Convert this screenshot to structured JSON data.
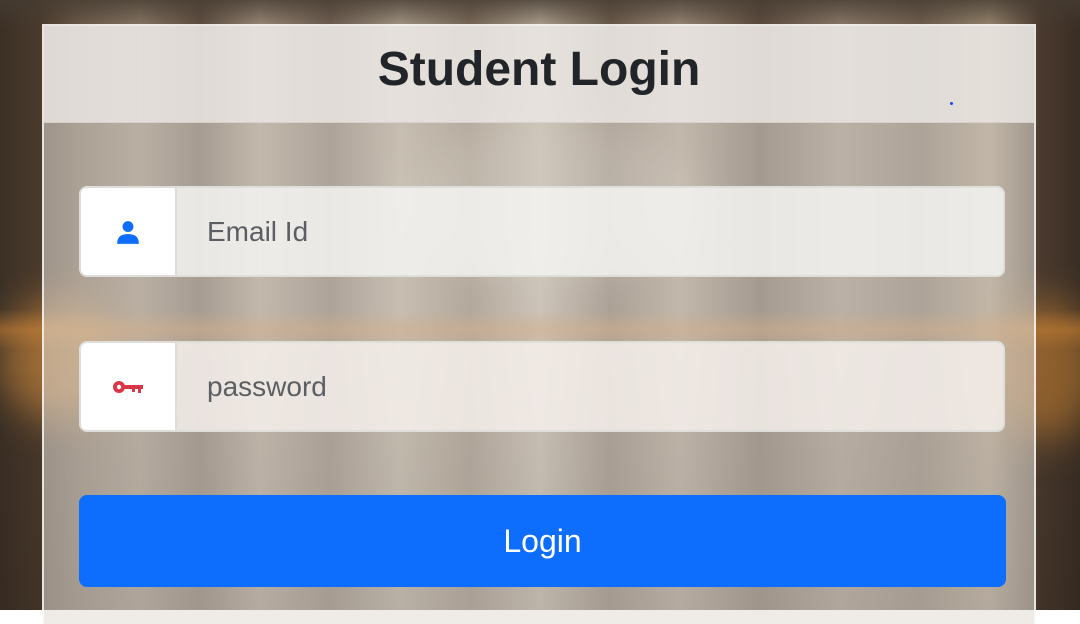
{
  "login_card": {
    "title": "Student Login",
    "email_field": {
      "placeholder": "Email Id",
      "value": "",
      "icon": "user-icon",
      "icon_color": "#0d6efd"
    },
    "password_field": {
      "placeholder": "password",
      "value": "",
      "icon": "key-icon",
      "icon_color": "#dc3545"
    },
    "login_button_label": "Login",
    "button_color": "#0d6efd"
  }
}
